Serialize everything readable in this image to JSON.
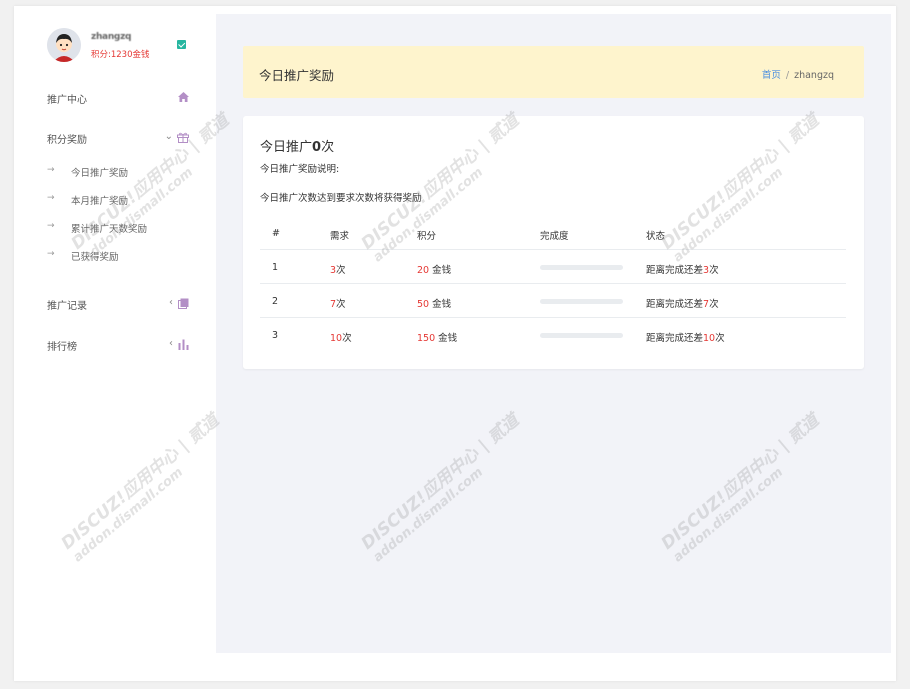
{
  "user": {
    "name": "zhangzq",
    "points": "积分:1230金钱"
  },
  "sidebar": {
    "items": [
      {
        "label": "推广中心",
        "icon": "home-icon"
      },
      {
        "label": "积分奖励",
        "icon": "gift-icon",
        "expanded": true,
        "children": [
          "今日推广奖励",
          "本月推广奖励",
          "累计推广天数奖励",
          "已获得奖励"
        ]
      },
      {
        "label": "推广记录",
        "icon": "book-icon"
      },
      {
        "label": "排行榜",
        "icon": "bar-chart-icon"
      }
    ]
  },
  "banner": {
    "title": "今日推广奖励",
    "breadcrumb_home": "首页",
    "breadcrumb_sep": "/",
    "breadcrumb_current": "zhangzq"
  },
  "card": {
    "title_prefix": "今日推广",
    "title_count": "0",
    "title_suffix": "次",
    "desc_label": "今日推广奖励说明:",
    "desc_text": "今日推广次数达到要求次数将获得奖励",
    "columns": [
      "#",
      "需求",
      "积分",
      "完成度",
      "状态"
    ],
    "rows": [
      {
        "idx": "1",
        "need": "3",
        "need_unit": "次",
        "points": "20",
        "points_unit": " 金钱",
        "progress": 0,
        "status_prefix": "距离完成还差",
        "status_num": "3",
        "status_unit": "次"
      },
      {
        "idx": "2",
        "need": "7",
        "need_unit": "次",
        "points": "50",
        "points_unit": " 金钱",
        "progress": 0,
        "status_prefix": "距离完成还差",
        "status_num": "7",
        "status_unit": "次"
      },
      {
        "idx": "3",
        "need": "10",
        "need_unit": "次",
        "points": "150",
        "points_unit": " 金钱",
        "progress": 0,
        "status_prefix": "距离完成还差",
        "status_num": "10",
        "status_unit": "次"
      }
    ]
  },
  "watermark": {
    "line1": "DISCUZ!应用中心 | 贰道",
    "line2": "addon.dismall.com"
  },
  "colors": {
    "accent": "#4a8ee0",
    "red": "#e53935",
    "banner_bg": "#fef4cd",
    "main_bg": "#f2f3f8"
  }
}
